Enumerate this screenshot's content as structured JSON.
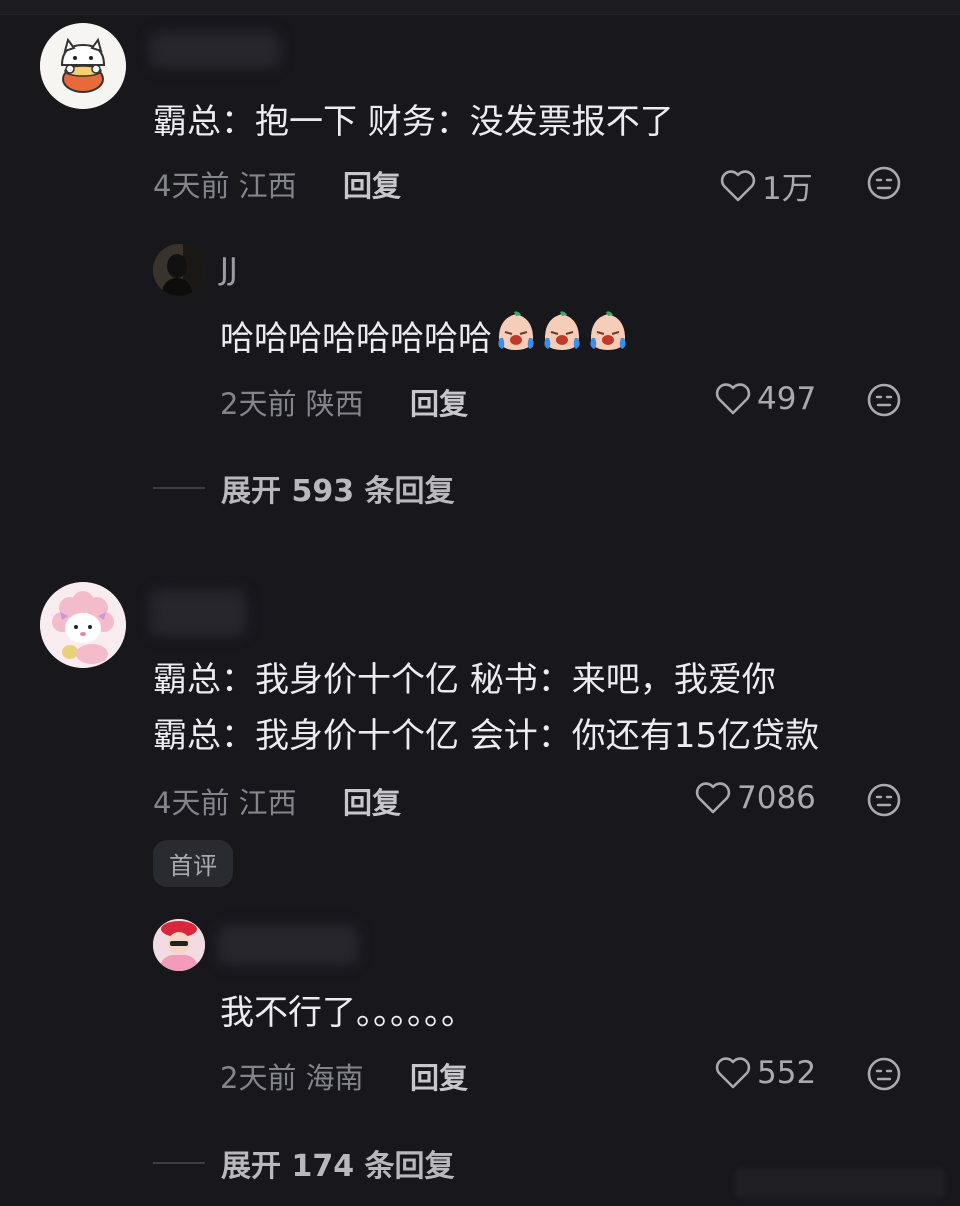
{
  "comments": [
    {
      "text_lines": [
        "霸总：抱一下 财务：没发票报不了"
      ],
      "time": "4天前",
      "location": "江西",
      "reply_label": "回复",
      "likes": "1万",
      "avatar_icon": "white-cat-with-bowl",
      "reply": {
        "username": "JJ",
        "text": "哈哈哈哈哈哈哈哈",
        "emoji_icon": "crying-laughing-face",
        "time": "2天前",
        "location": "陕西",
        "reply_label": "回复",
        "likes": "497",
        "avatar_icon": "dark-person-silhouette"
      },
      "expand_label": "展开 593 条回复"
    },
    {
      "text_lines": [
        "霸总：我身价十个亿 秘书：来吧，我爱你",
        "霸总：我身价十个亿 会计：你还有15亿贷款"
      ],
      "time": "4天前",
      "location": "江西",
      "reply_label": "回复",
      "likes": "7086",
      "badge": "首评",
      "avatar_icon": "pink-sheep-character",
      "reply": {
        "text": "我不行了。。。。。。",
        "time": "2天前",
        "location": "海南",
        "reply_label": "回复",
        "likes": "552",
        "avatar_icon": "girl-red-beret"
      },
      "expand_label": "展开 174 条回复"
    }
  ],
  "icons": {
    "like": "heart-outline-icon",
    "dislike": "neutral-face-icon"
  },
  "colors": {
    "background": "#17171c",
    "text": "#ececf0",
    "meta": "#84848c"
  }
}
